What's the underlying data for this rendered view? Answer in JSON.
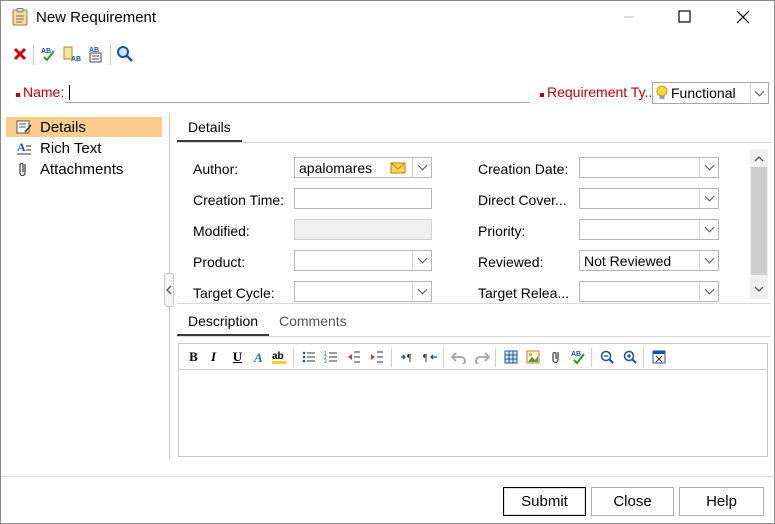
{
  "window": {
    "title": "New Requirement",
    "icons": [
      "clipboard-icon",
      "minimize-icon",
      "maximize-icon",
      "close-icon"
    ]
  },
  "toolbar": {
    "icons": [
      "delete-icon",
      "spell-check-icon",
      "spell-options-icon",
      "thesaurus-icon",
      "find-icon"
    ]
  },
  "name_row": {
    "name_label": "Name:",
    "name_value": "",
    "type_label": "Requirement Ty...",
    "type_value": "Functional",
    "type_icon": "lightbulb-icon"
  },
  "nav": {
    "items": [
      {
        "label": "Details",
        "icon": "details-icon",
        "selected": true
      },
      {
        "label": "Rich Text",
        "icon": "rich-text-icon",
        "selected": false
      },
      {
        "label": "Attachments",
        "icon": "paperclip-icon",
        "selected": false
      }
    ]
  },
  "details_tab": {
    "label": "Details"
  },
  "fields": {
    "author": {
      "label": "Author:",
      "value": "apalomares"
    },
    "creation_time": {
      "label": "Creation Time:",
      "value": ""
    },
    "modified": {
      "label": "Modified:",
      "value": ""
    },
    "product": {
      "label": "Product:",
      "value": ""
    },
    "target_cycle": {
      "label": "Target Cycle:",
      "value": ""
    },
    "creation_date": {
      "label": "Creation Date:",
      "value": ""
    },
    "direct_cover": {
      "label": "Direct Cover...",
      "value": ""
    },
    "priority": {
      "label": "Priority:",
      "value": ""
    },
    "reviewed": {
      "label": "Reviewed:",
      "value": "Not Reviewed"
    },
    "target_release": {
      "label": "Target Relea...",
      "value": ""
    }
  },
  "lower_tabs": [
    {
      "label": "Description",
      "active": true
    },
    {
      "label": "Comments",
      "active": false
    }
  ],
  "editor_toolbar": {
    "bold": "B",
    "italic": "I",
    "underline": "U",
    "icons": [
      "font-color-icon",
      "highlight-icon",
      "bullet-list-icon",
      "numbered-list-icon",
      "decrease-indent-icon",
      "increase-indent-icon",
      "ltr-icon",
      "rtl-icon",
      "undo-icon",
      "redo-icon",
      "table-icon",
      "image-icon",
      "attach-icon",
      "spell-check-icon",
      "zoom-out-icon",
      "zoom-in-icon",
      "clear-format-icon"
    ]
  },
  "buttons": {
    "submit": "Submit",
    "close": "Close",
    "help": "Help"
  },
  "colors": {
    "selection": "#fbcd8d",
    "required": "#c00000"
  }
}
